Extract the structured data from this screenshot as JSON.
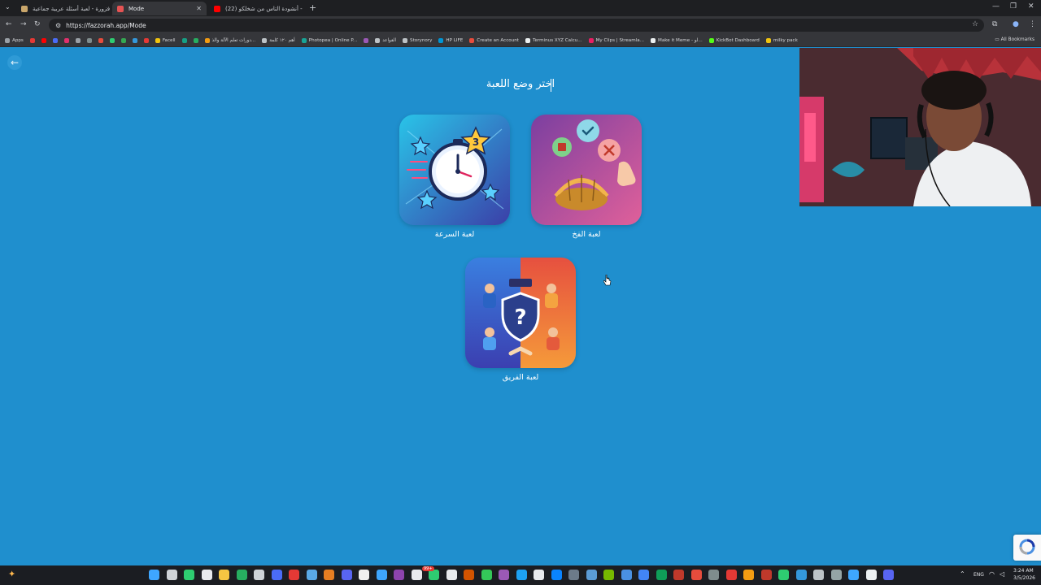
{
  "browser": {
    "tabs": [
      {
        "title": "فزورة - لعبة أسئلة عربية جماعية ...",
        "color": "#c9a66b"
      },
      {
        "title": "Mode",
        "color": "#e55353"
      },
      {
        "title": "(22) أنشودة التاس من شخلكو - ...",
        "color": "#ff0000"
      }
    ],
    "url": "https://fazzorah.app/Mode",
    "bookmarks": [
      {
        "label": "Apps",
        "color": "#9aa0a6"
      },
      {
        "label": "",
        "color": "#e53935"
      },
      {
        "label": "",
        "color": "#ff0000"
      },
      {
        "label": "",
        "color": "#4a6cf7"
      },
      {
        "label": "",
        "color": "#e1306c"
      },
      {
        "label": "",
        "color": "#9aa0a6"
      },
      {
        "label": "",
        "color": "#7f8c8d"
      },
      {
        "label": "",
        "color": "#e74c3c"
      },
      {
        "label": "",
        "color": "#2ecc71"
      },
      {
        "label": "",
        "color": "#34a853"
      },
      {
        "label": "",
        "color": "#3498db"
      },
      {
        "label": "",
        "color": "#e53935"
      },
      {
        "label": "Facell",
        "color": "#f1c40f"
      },
      {
        "label": "",
        "color": "#16a085"
      },
      {
        "label": "",
        "color": "#27ae60"
      },
      {
        "label": "دورات تعلم الآلة والذ...",
        "color": "#f39c12"
      },
      {
        "label": "أهم ١٢٠ كلمة",
        "color": "#bdc3c7"
      },
      {
        "label": "Photopea | Online P...",
        "color": "#18a497"
      },
      {
        "label": "",
        "color": "#9b59b6"
      },
      {
        "label": "القواعد",
        "color": "#bdc3c7"
      },
      {
        "label": "Storynory",
        "color": "#bdc3c7"
      },
      {
        "label": "HP LIFE",
        "color": "#0096d6"
      },
      {
        "label": "Create an Account",
        "color": "#e74c3c"
      },
      {
        "label": "Terminus XYZ Calcu...",
        "color": "#ecf0f1"
      },
      {
        "label": "My Clips | Streamla...",
        "color": "#e91e63"
      },
      {
        "label": "Make it Meme - لو...",
        "color": "#ecf0f1"
      },
      {
        "label": "KickBot Dashboard",
        "color": "#53fc18"
      },
      {
        "label": "milky pack",
        "color": "#f1c40f"
      }
    ],
    "all_bookmarks": "All Bookmarks"
  },
  "page": {
    "title": "اختر وضع اللعبة",
    "modes": {
      "speed": "لعبة السرعة",
      "trap": "لعبة الفخ",
      "team": "لعبة الفريق"
    }
  },
  "taskbar": {
    "lang": "ENG",
    "time": "3:24 AM",
    "date": "3/5/2026",
    "badge": "99+"
  },
  "icons": {
    "back": "arrow-left-icon",
    "star_number": "3"
  }
}
